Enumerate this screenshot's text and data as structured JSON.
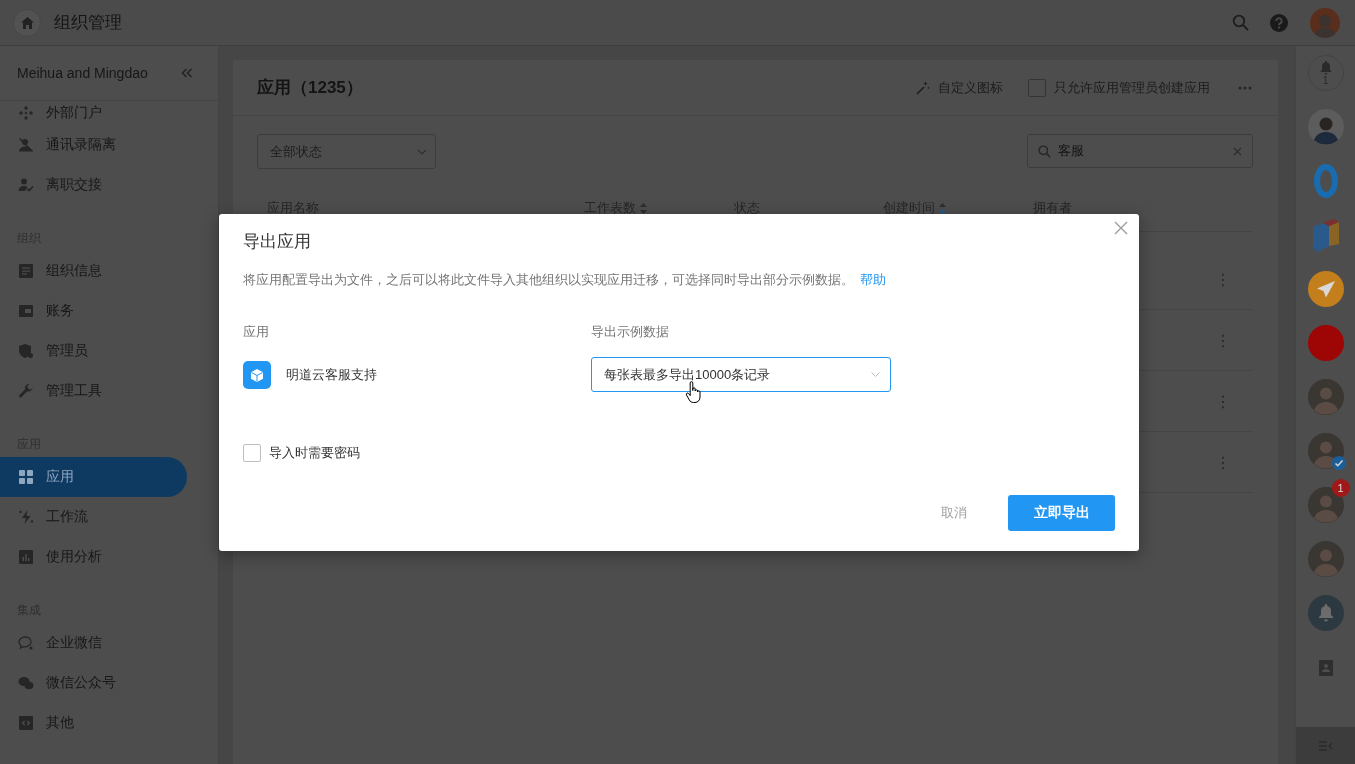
{
  "top_bar": {
    "title": "组织管理"
  },
  "sidebar": {
    "org_name": "Meihua and Mingdao",
    "groups": [
      {
        "items": [
          {
            "label": "外部门户",
            "selected": false
          },
          {
            "label": "通讯录隔离",
            "selected": false
          },
          {
            "label": "离职交接",
            "selected": false
          }
        ]
      },
      {
        "heading": "组织",
        "items": [
          {
            "label": "组织信息",
            "selected": false
          },
          {
            "label": "账务",
            "selected": false
          },
          {
            "label": "管理员",
            "selected": false
          },
          {
            "label": "管理工具",
            "selected": false
          }
        ]
      },
      {
        "heading": "应用",
        "items": [
          {
            "label": "应用",
            "selected": true
          },
          {
            "label": "工作流",
            "selected": false
          },
          {
            "label": "使用分析",
            "selected": false
          }
        ]
      },
      {
        "heading": "集成",
        "items": [
          {
            "label": "企业微信",
            "selected": false
          },
          {
            "label": "微信公众号",
            "selected": false
          },
          {
            "label": "其他",
            "selected": false
          }
        ]
      }
    ]
  },
  "main": {
    "title": "应用（1235）",
    "custom_icon_button": "自定义图标",
    "admin_only": {
      "label": "只允许应用管理员创建应用",
      "checked": false
    },
    "status_filter": {
      "value": "全部状态"
    },
    "search": {
      "value": "客服"
    },
    "table": {
      "columns": [
        {
          "label": "应用名称"
        },
        {
          "label": "工作表数",
          "sortable": true,
          "sorted": false
        },
        {
          "label": "状态"
        },
        {
          "label": "创建时间",
          "sortable": true,
          "sorted": true
        },
        {
          "label": "拥有者"
        }
      ],
      "rows": [
        {
          "menu": "⋮"
        },
        {
          "menu": "⋮"
        },
        {
          "menu": "⋮"
        },
        {
          "menu": "⋮"
        }
      ]
    }
  },
  "dialog": {
    "title": "导出应用",
    "description": "将应用配置导出为文件，之后可以将此文件导入其他组织以实现应用迁移，可选择同时导出部分示例数据。",
    "help_link": "帮助",
    "app_label": "应用",
    "app_name": "明道云客服支持",
    "sample_label": "导出示例数据",
    "sample_select": {
      "value": "每张表最多导出10000条记录",
      "focused": true
    },
    "password": {
      "label": "导入时需要密码",
      "checked": false
    },
    "cancel": "取消",
    "confirm": "立即导出"
  },
  "rail": {
    "items": [
      {
        "kind": "bell",
        "count": "1"
      },
      {
        "kind": "avatar",
        "verified": false
      },
      {
        "kind": "ring"
      },
      {
        "kind": "boxes"
      },
      {
        "kind": "send",
        "color": "#c47f1d"
      },
      {
        "kind": "dot",
        "color": "#9e0505"
      },
      {
        "kind": "photo",
        "verified": false
      },
      {
        "kind": "photo",
        "verified": true
      },
      {
        "kind": "photo",
        "verified": false,
        "badge": "1"
      },
      {
        "kind": "photo",
        "verified": false
      },
      {
        "kind": "alarm"
      },
      {
        "kind": "contacts"
      }
    ]
  }
}
